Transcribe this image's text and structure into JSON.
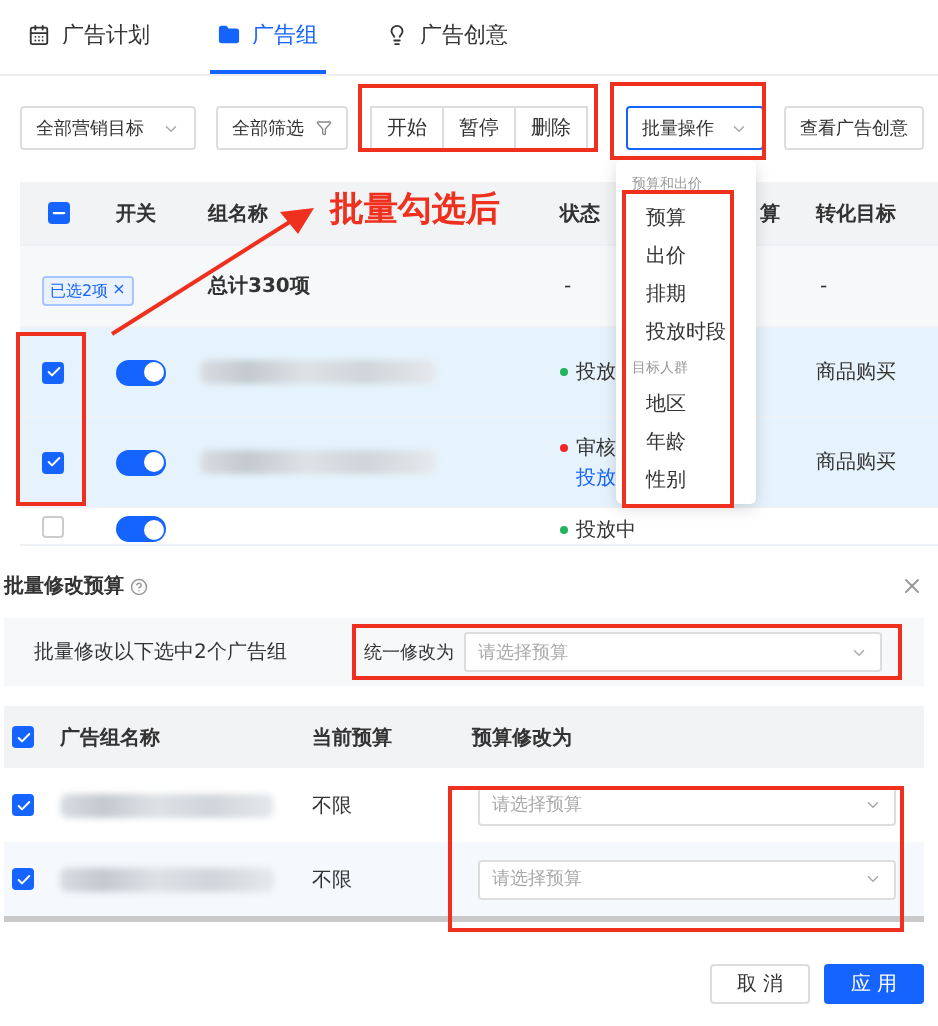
{
  "tabs": [
    {
      "label": "广告计划",
      "selected": false
    },
    {
      "label": "广告组",
      "selected": true
    },
    {
      "label": "广告创意",
      "selected": false
    }
  ],
  "toolbar": {
    "goal_select": "全部营销目标",
    "filter_button": "全部筛选",
    "actions": [
      "开始",
      "暂停",
      "删除"
    ],
    "batch_select": {
      "label": "批量操作",
      "expanded": true
    },
    "view_button": "查看广告创意"
  },
  "table": {
    "header_checkbox": {
      "indeterminate": true
    },
    "columns": [
      "开关",
      "组名称",
      "状态",
      "算",
      "转化目标"
    ],
    "summary": {
      "badge": "已选2项",
      "badge_close": "×",
      "total": "总计330项",
      "status": "-",
      "conversion": "-"
    },
    "rows": [
      {
        "checked": true,
        "on": true,
        "status": [
          {
            "text": "投放",
            "color": "#22b35e"
          }
        ],
        "conversion": "商品购买"
      },
      {
        "checked": true,
        "on": true,
        "status": [
          {
            "text": "审核",
            "color": "#f5222d"
          },
          {
            "text": "投放",
            "link": true
          }
        ],
        "conversion": "商品购买"
      },
      {
        "checked": false,
        "on": true,
        "status": [
          {
            "text": "投放中",
            "color": "#22b35e"
          }
        ]
      }
    ]
  },
  "dropdown": {
    "groups": [
      {
        "label": "预算和出价",
        "items": [
          "预算",
          "出价",
          "排期",
          "投放时段"
        ]
      },
      {
        "label": "目标人群",
        "items": [
          "地区",
          "年龄",
          "性别"
        ]
      }
    ]
  },
  "annotation": "批量勾选后",
  "dialog": {
    "title": "批量修改预算",
    "info": "批量修改以下选中2个广告组",
    "unify_label": "统一修改为",
    "unify_placeholder": "请选择预算",
    "header_checked": true,
    "columns": [
      "广告组名称",
      "当前预算",
      "预算修改为"
    ],
    "rows": [
      {
        "checked": true,
        "current": "不限",
        "placeholder": "请选择预算"
      },
      {
        "checked": true,
        "current": "不限",
        "placeholder": "请选择预算"
      }
    ],
    "buttons": [
      {
        "label": "取 消",
        "primary": false
      },
      {
        "label": "应 用",
        "primary": true
      }
    ]
  }
}
